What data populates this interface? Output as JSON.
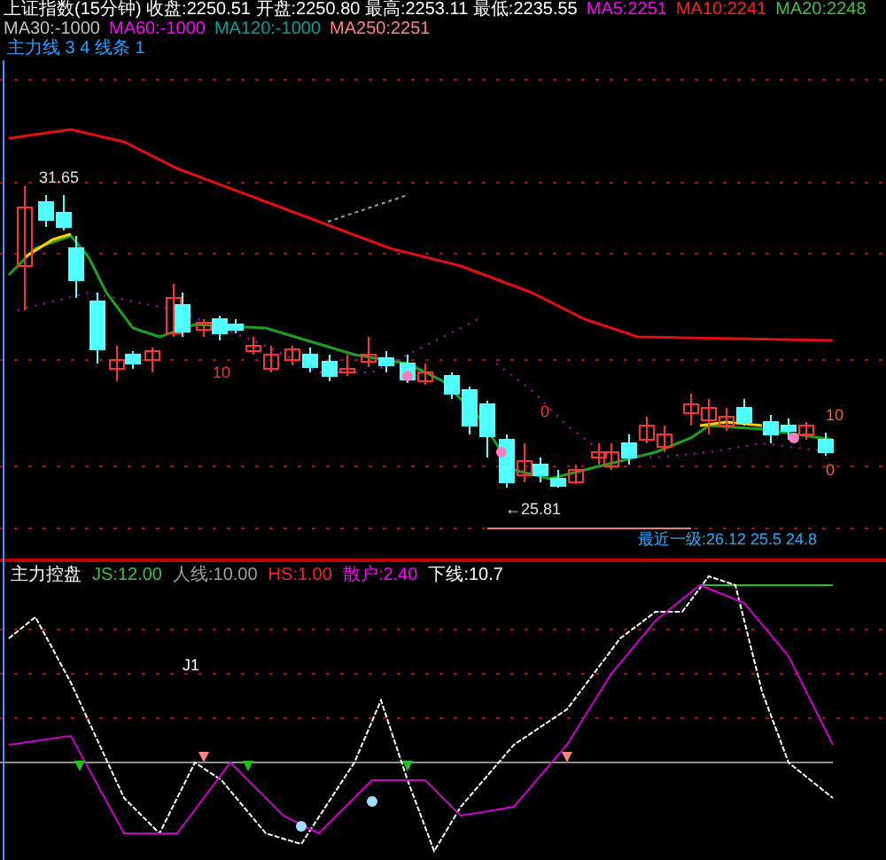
{
  "header": [
    {
      "text": "上证指数(15分钟) 收盘:2250.51 开盘:2250.80 最高:2253.11 最低:2235.55",
      "color": "#ffffff"
    },
    {
      "text": "MA5:2251",
      "color": "#ff00ff"
    },
    {
      "text": "MA10:2241",
      "color": "#ff2020"
    },
    {
      "text": "MA20:2248",
      "color": "#40c040"
    },
    {
      "text": "MA30:-1000",
      "color": "#c0c0c0"
    },
    {
      "text": "MA60:-1000",
      "color": "#ff00ff"
    },
    {
      "text": "MA120:-1000",
      "color": "#00a0a0"
    },
    {
      "text": "MA250:2251",
      "color": "#ff8080"
    }
  ],
  "subtitle": "主力线 3 4 线条 1",
  "main_labels": [
    {
      "kind": "high",
      "text": "31.65"
    },
    {
      "kind": "low",
      "text": "←25.81"
    },
    {
      "kind": "right_upper",
      "text": "10"
    },
    {
      "kind": "right_lower",
      "text": "0"
    },
    {
      "kind": "left_mark",
      "text": "10"
    },
    {
      "kind": "mid_mark",
      "text": "0"
    }
  ],
  "range_text": "最近一级:26.12 25.5 24.8",
  "indicator_header": [
    {
      "text": "主力控盘",
      "color": "#ffffff"
    },
    {
      "text": "JS:12.00",
      "color": "#40c040"
    },
    {
      "text": "人线:10.00",
      "color": "#a0a0a0"
    },
    {
      "text": "HS:1.00",
      "color": "#ff2020"
    },
    {
      "text": "散户:2.40",
      "color": "#ff00ff"
    },
    {
      "text": "下线:10.7",
      "color": "#ffffff"
    }
  ],
  "indicator_label": "J1"
}
